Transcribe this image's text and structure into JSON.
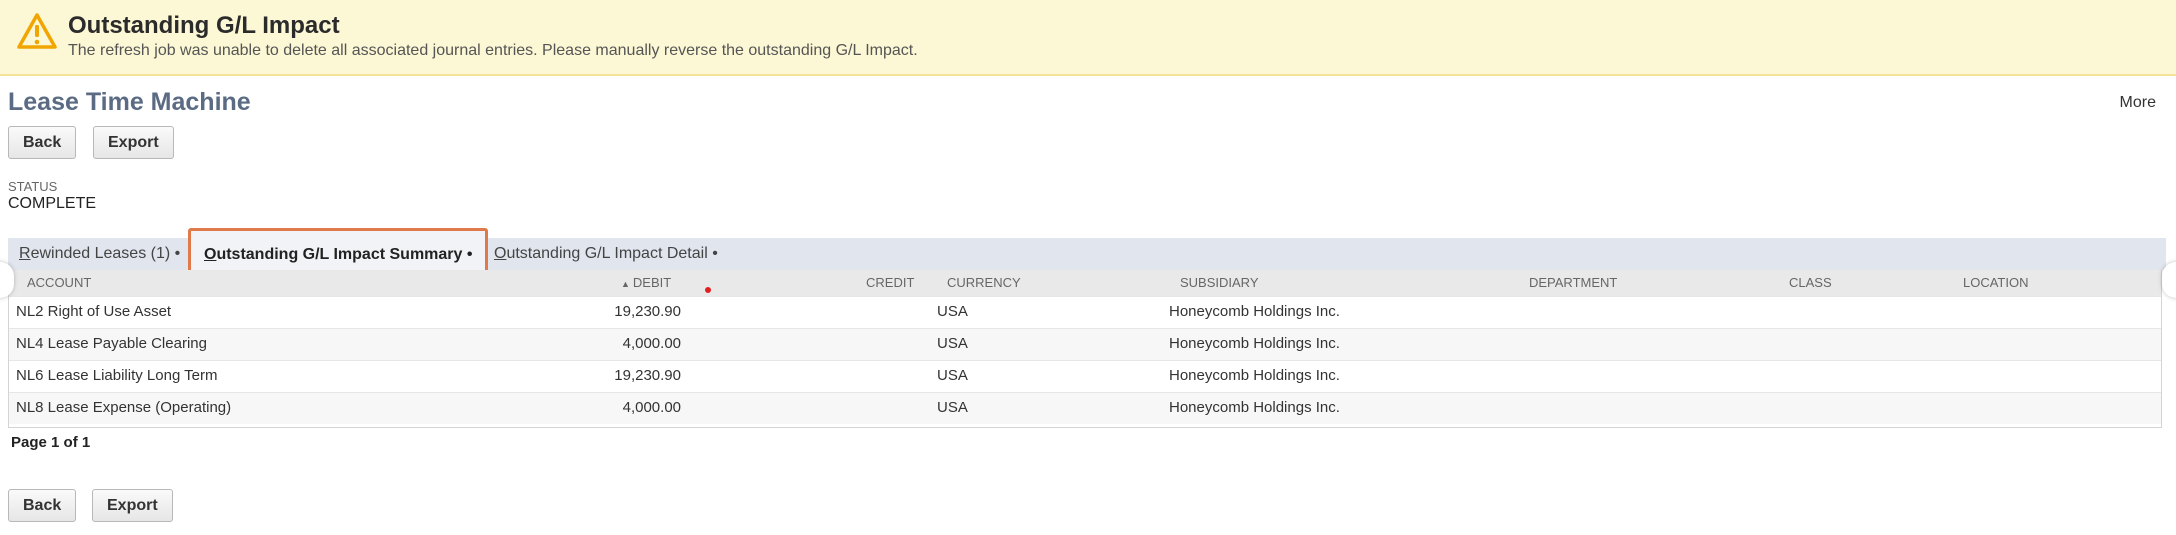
{
  "alert": {
    "icon": "warning-triangle-icon",
    "title": "Outstanding G/L Impact",
    "message": "The refresh job was unable to delete all associated journal entries. Please manually reverse the outstanding G/L Impact.",
    "background": "#fcf7d4",
    "icon_color": "#f0a500"
  },
  "page": {
    "title": "Lease Time Machine",
    "more_label": "More"
  },
  "toolbar_top": {
    "back_label": "Back",
    "export_label": "Export"
  },
  "toolbar_bottom": {
    "back_label": "Back",
    "export_label": "Export"
  },
  "status": {
    "label": "STATUS",
    "value": "COMPLETE"
  },
  "tabs": [
    {
      "accesskey": "R",
      "rest": "ewinded Leases (1)",
      "dot": "•",
      "active": false
    },
    {
      "accesskey": "O",
      "rest": "utstanding G/L Impact Summary",
      "dot": "•",
      "active": true
    },
    {
      "accesskey": "O",
      "rest": "utstanding G/L Impact Detail",
      "dot": "•",
      "active": false
    }
  ],
  "table": {
    "headers": {
      "account": "ACCOUNT",
      "debit_arrow": "▲",
      "debit": "DEBIT",
      "credit": "CREDIT",
      "currency": "CURRENCY",
      "subsidiary": "SUBSIDIARY",
      "department": "DEPARTMENT",
      "class": "CLASS",
      "location": "LOCATION"
    },
    "rows": [
      {
        "account": "NL2 Right of Use Asset",
        "debit": "19,230.90",
        "credit": "",
        "currency": "USA",
        "subsidiary": "Honeycomb Holdings Inc.",
        "department": "",
        "class": "",
        "location": ""
      },
      {
        "account": "NL4 Lease Payable Clearing",
        "debit": "4,000.00",
        "credit": "",
        "currency": "USA",
        "subsidiary": "Honeycomb Holdings Inc.",
        "department": "",
        "class": "",
        "location": ""
      },
      {
        "account": "NL6 Lease Liability Long Term",
        "debit": "19,230.90",
        "credit": "",
        "currency": "USA",
        "subsidiary": "Honeycomb Holdings Inc.",
        "department": "",
        "class": "",
        "location": ""
      },
      {
        "account": "NL8 Lease Expense (Operating)",
        "debit": "4,000.00",
        "credit": "",
        "currency": "USA",
        "subsidiary": "Honeycomb Holdings Inc.",
        "department": "",
        "class": "",
        "location": ""
      }
    ]
  },
  "pager": {
    "text": "Page 1 of 1"
  },
  "colors": {
    "title": "#5a6b83",
    "active_tab_border": "#e07a4a",
    "tab_bar": "#e1e5ee"
  }
}
